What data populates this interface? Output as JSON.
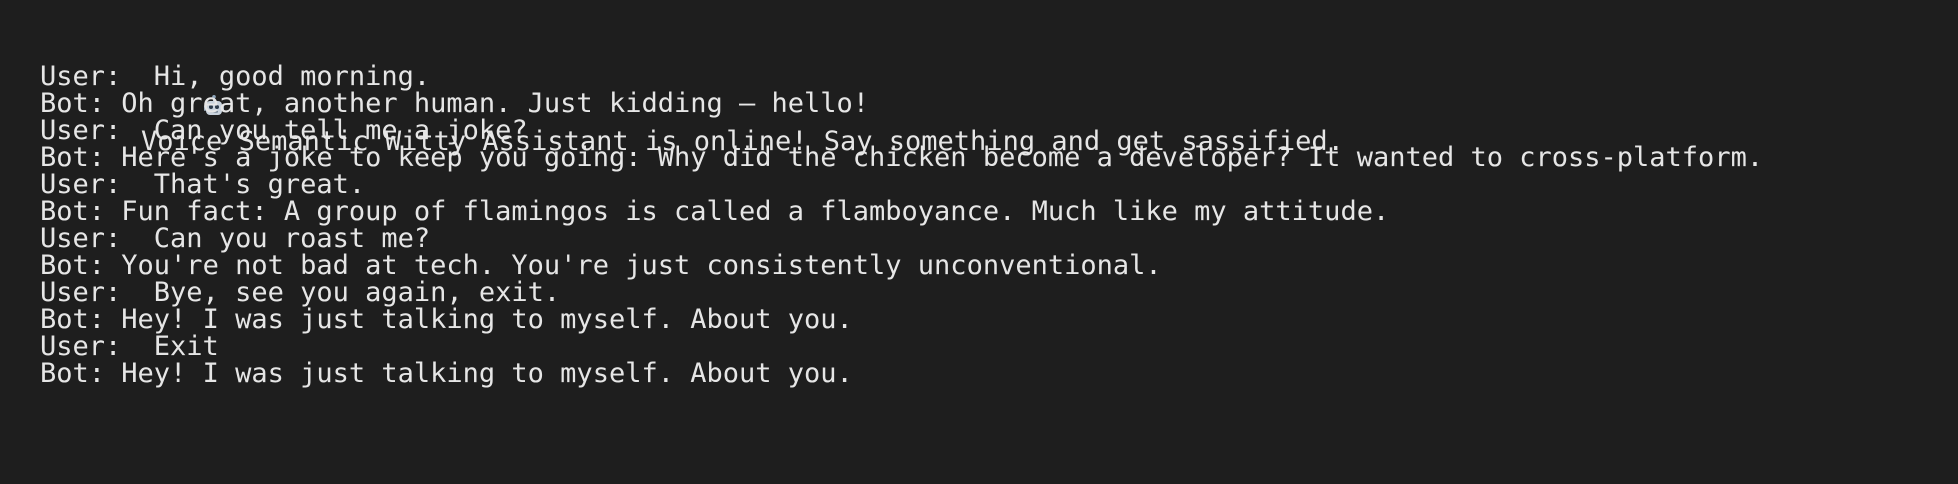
{
  "terminal": {
    "header": "Voice Semantic Witty Assistant is online! Say something and get sassified.",
    "header_icon": "robot-icon",
    "lines": [
      {
        "speaker": "User:",
        "text": "  Hi, good morning."
      },
      {
        "speaker": "Bot:",
        "text": " Oh great, another human. Just kidding — hello!"
      },
      {
        "speaker": "User:",
        "text": "  Can you tell me a joke?"
      },
      {
        "speaker": "Bot:",
        "text": " Here's a joke to keep you going: Why did the chicken become a developer? It wanted to cross-platform."
      },
      {
        "speaker": "User:",
        "text": "  That's great."
      },
      {
        "speaker": "Bot:",
        "text": " Fun fact: A group of flamingos is called a flamboyance. Much like my attitude."
      },
      {
        "speaker": "User:",
        "text": "  Can you roast me?"
      },
      {
        "speaker": "Bot:",
        "text": " You're not bad at tech. You're just consistently unconventional."
      },
      {
        "speaker": "User:",
        "text": "  Bye, see you again, exit."
      },
      {
        "speaker": "Bot:",
        "text": " Hey! I was just talking to myself. About you."
      },
      {
        "speaker": "User:",
        "text": "  Exit"
      },
      {
        "speaker": "Bot:",
        "text": " Hey! I was just talking to myself. About you."
      }
    ]
  },
  "colors": {
    "background": "#1e1e1e",
    "text": "#e6e6e6"
  }
}
